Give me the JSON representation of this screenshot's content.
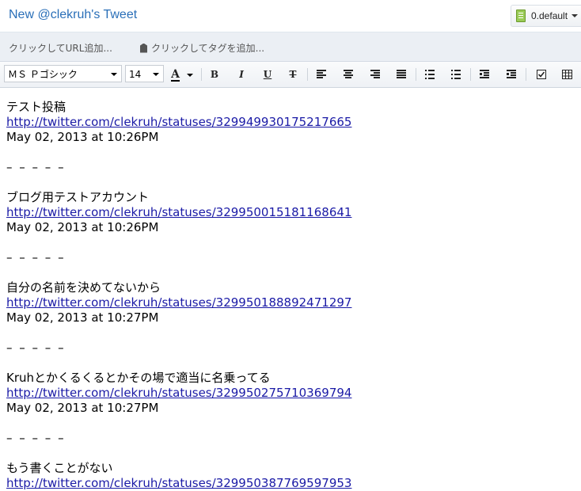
{
  "header": {
    "title": "New @clekruh's Tweet",
    "notebook": "0.default"
  },
  "tagbar": {
    "url_placeholder": "クリックしてURL追加...",
    "tag_placeholder": "クリックしてタグを追加..."
  },
  "toolbar": {
    "font": "ＭＳ Ｐゴシック",
    "size": "14",
    "font_color_glyph": "A",
    "bold": "B",
    "italic": "I",
    "underline": "U",
    "strike": "T"
  },
  "entries": [
    {
      "text": "テスト投稿",
      "url": "http://twitter.com/clekruh/statuses/329949930175217665",
      "date": "May 02, 2013 at 10:26PM",
      "separator": "– – – – –"
    },
    {
      "text": "ブログ用テストアカウント",
      "url": "http://twitter.com/clekruh/statuses/329950015181168641",
      "date": "May 02, 2013 at 10:26PM",
      "separator": "– – – – –"
    },
    {
      "text": "自分の名前を決めてないから",
      "url": "http://twitter.com/clekruh/statuses/329950188892471297",
      "date": "May 02, 2013 at 10:27PM",
      "separator": "– – – – –"
    },
    {
      "text": "Kruhとかくるくるとかその場で適当に名乗ってる",
      "url": "http://twitter.com/clekruh/statuses/329950275710369794",
      "date": "May 02, 2013 at 10:27PM",
      "separator": "– – – – –"
    },
    {
      "text": "もう書くことがない",
      "url": "http://twitter.com/clekruh/statuses/329950387769597953",
      "date": "",
      "separator": ""
    }
  ]
}
